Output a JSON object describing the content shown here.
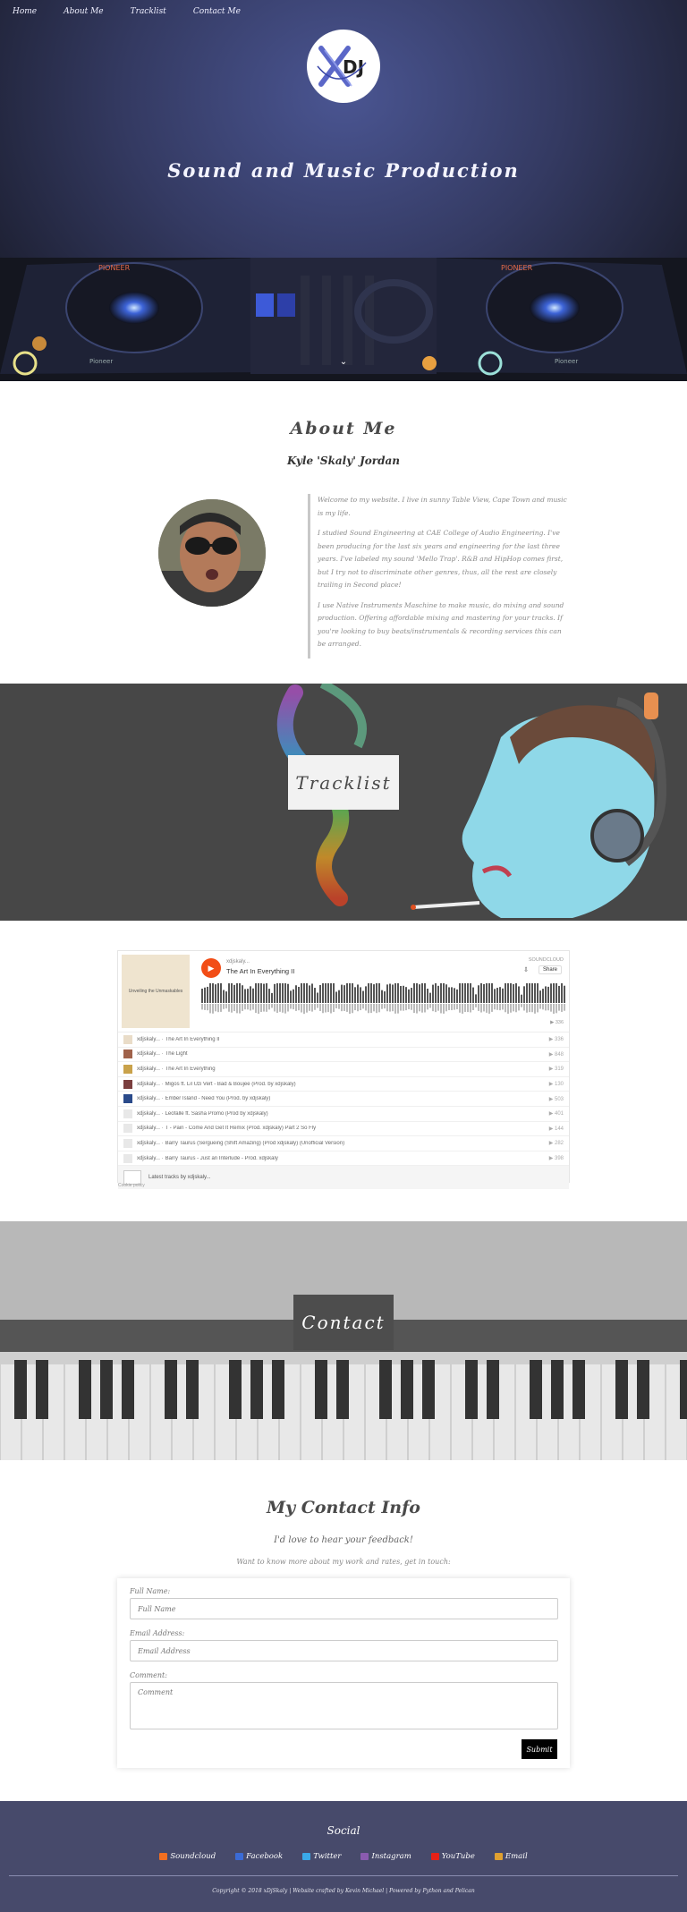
{
  "nav": {
    "items": [
      "Home",
      "About Me",
      "Tracklist",
      "Contact Me"
    ]
  },
  "hero": {
    "title": "Sound and Music Production",
    "logo_text": "XDJ"
  },
  "about": {
    "title": "About Me",
    "subtitle": "Kyle 'Skaly' Jordan",
    "paragraphs": [
      "Welcome to my website. I live in sunny Table View, Cape Town and music is my life.",
      "I studied Sound Engineering at CAE College of Audio Engineering. I've been producing for the last six years and engineering for the last three years. I've labeled my sound 'Mello Trap'. R&B and HipHop comes first, but I try not to discriminate other genres, thus, all the rest are closely trailing in Second place!",
      "I use Native Instruments Maschine to make music, do mixing and sound production. Offering affordable mixing and mastering for your tracks. If you're looking to buy beats/instrumentals & recording services this can be arranged."
    ]
  },
  "tracklist_banner": {
    "label": "Tracklist"
  },
  "player": {
    "cover_text": "Unveiling the Unmaskables",
    "artist": "xdjskaly...",
    "track": "The Art In Everything II",
    "brand": "SOUNDCLOUD",
    "share": "Share",
    "plays": "▶ 336",
    "tracks": [
      {
        "artist": "xdjskaly...",
        "title": "The Art In Everything II",
        "count": "336",
        "color": "#e9dcc8"
      },
      {
        "artist": "xdjskaly...",
        "title": "The Light",
        "count": "848",
        "color": "#a0624a"
      },
      {
        "artist": "xdjskaly...",
        "title": "The Art In Everything",
        "count": "319",
        "color": "#c9a24a"
      },
      {
        "artist": "xdjskaly...",
        "title": "Migos ft. Lil Uzi Vert - Bad & Boujee (Prod. by xdjskaly)",
        "count": "130",
        "color": "#7a3e3e"
      },
      {
        "artist": "xdjskaly...",
        "title": "Ember Island - Need You (Prod. by xdjskaly)",
        "count": "503",
        "color": "#2a4a8a"
      },
      {
        "artist": "xdjskaly...",
        "title": "Leofalle ft. Sasha Promo (Prod by xdjskaly)",
        "count": "401",
        "color": "#e8e8e8"
      },
      {
        "artist": "xdjskaly...",
        "title": "T - Pain - Come And Get It Remix (Prod. xdjskaly) Part 2 So Fly",
        "count": "144",
        "color": "#e8e8e8"
      },
      {
        "artist": "xdjskaly...",
        "title": "Barry Taurus (Sergueing (Shift Amazing) (Prod xdjskaly) (Unofficial Version)",
        "count": "282",
        "color": "#e8e8e8"
      },
      {
        "artist": "xdjskaly...",
        "title": "Barry Taurus - Just an Interlude - Prod. xdjskaly",
        "count": "398",
        "color": "#e8e8e8"
      }
    ],
    "footer_text": "Latest tracks by xdjskaly...",
    "cookie": "Cookie policy"
  },
  "contact_banner": {
    "label": "Contact"
  },
  "contact": {
    "title": "My Contact Info",
    "tagline": "I'd love to hear your feedback!",
    "intro": "Want to know more about my work and rates, get in touch:",
    "name_label": "Full Name:",
    "name_placeholder": "Full Name",
    "email_label": "Email Address:",
    "email_placeholder": "Email Address",
    "comment_label": "Comment:",
    "comment_placeholder": "Comment",
    "submit": "Submit"
  },
  "footer": {
    "title": "Social",
    "links": [
      {
        "label": "Soundcloud",
        "color": "#f26f21"
      },
      {
        "label": "Facebook",
        "color": "#3b6bd6"
      },
      {
        "label": "Twitter",
        "color": "#3aa9e8"
      },
      {
        "label": "Instagram",
        "color": "#8a5bb0"
      },
      {
        "label": "YouTube",
        "color": "#e62117"
      },
      {
        "label": "Email",
        "color": "#e0a030"
      }
    ],
    "copyright": "Copyright © 2018 xDjSkaly | Website crafted by Kevin Michael | Powered by Python and Pelican"
  }
}
